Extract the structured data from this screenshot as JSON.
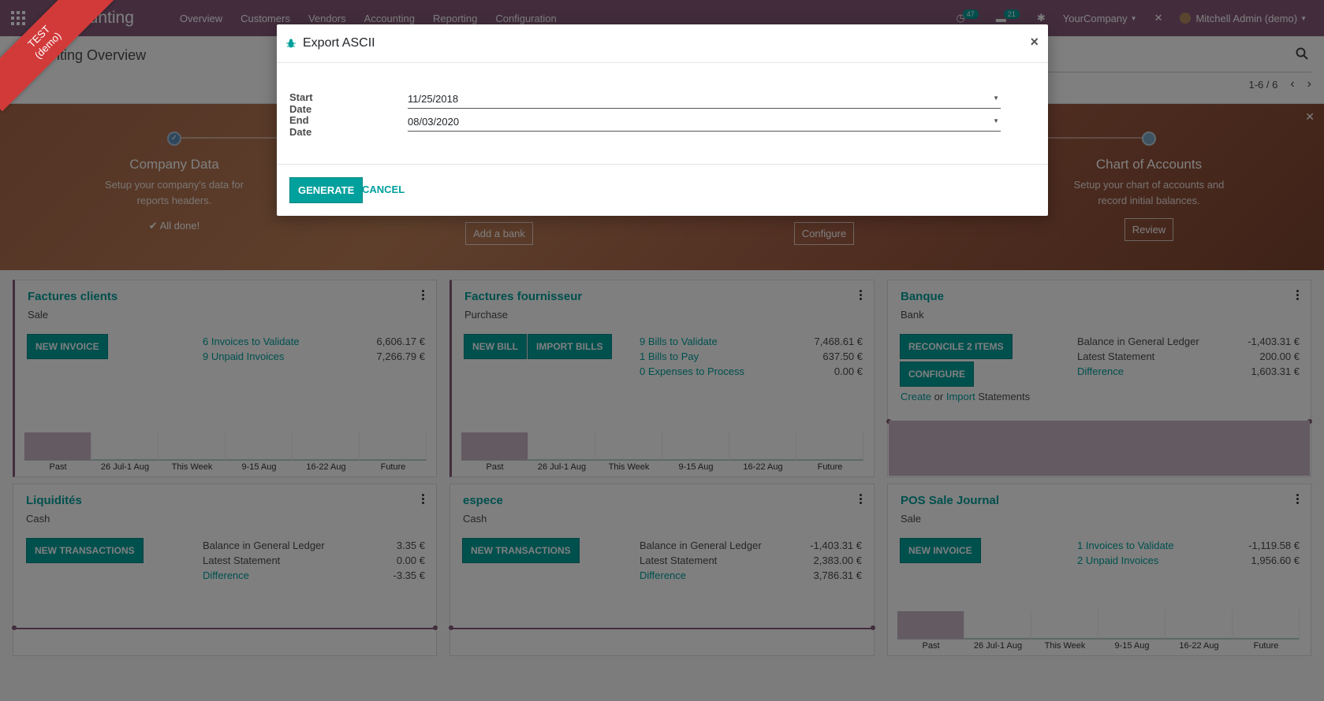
{
  "navbar": {
    "brand": "Accounting",
    "menu": [
      "Overview",
      "Customers",
      "Vendors",
      "Accounting",
      "Reporting",
      "Configuration"
    ],
    "activity_count": "47",
    "message_count": "21",
    "company": "YourCompany",
    "user": "Mitchell Admin (demo)"
  },
  "control_panel": {
    "breadcrumb": "Accounting Overview",
    "pager": "1-6 / 6"
  },
  "onboarding": {
    "steps": [
      {
        "title": "Company Data",
        "desc_line1": "Setup your company's data for",
        "desc_line2": "reports headers.",
        "done": "All done!"
      },
      {
        "button": "Add a bank"
      },
      {
        "button": "Configure"
      },
      {
        "title": "Chart of Accounts",
        "desc_line1": "Setup your chart of accounts and",
        "desc_line2": "record initial balances.",
        "button": "Review"
      }
    ]
  },
  "cards": {
    "factures_clients": {
      "title": "Factures clients",
      "type": "Sale",
      "button": "NEW INVOICE",
      "stats": [
        {
          "label": "6 Invoices to Validate",
          "value": "6,606.17 €"
        },
        {
          "label": "9 Unpaid Invoices",
          "value": "7,266.79 €"
        }
      ]
    },
    "factures_fournisseur": {
      "title": "Factures fournisseur",
      "type": "Purchase",
      "button1": "NEW BILL",
      "button2": "IMPORT BILLS",
      "stats": [
        {
          "label": "9 Bills to Validate",
          "value": "7,468.61 €"
        },
        {
          "label": "1 Bills to Pay",
          "value": "637.50 €"
        },
        {
          "label": "0 Expenses to Process",
          "value": "0.00 €"
        }
      ]
    },
    "banque": {
      "title": "Banque",
      "type": "Bank",
      "button1": "RECONCILE 2 ITEMS",
      "button2": "CONFIGURE",
      "stats": [
        {
          "label": "Balance in General Ledger",
          "value": "-1,403.31 €"
        },
        {
          "label": "Latest Statement",
          "value": "200.00 €"
        },
        {
          "label": "Difference",
          "value": "1,603.31 €"
        }
      ],
      "links": {
        "create": "Create",
        "or": "or",
        "import": "Import",
        "statements": "Statements"
      }
    },
    "liquidites": {
      "title": "Liquidités",
      "type": "Cash",
      "button": "NEW TRANSACTIONS",
      "stats": [
        {
          "label": "Balance in General Ledger",
          "value": "3.35 €"
        },
        {
          "label": "Latest Statement",
          "value": "0.00 €"
        },
        {
          "label": "Difference",
          "value": "-3.35 €"
        }
      ]
    },
    "espece": {
      "title": "espece",
      "type": "Cash",
      "button": "NEW TRANSACTIONS",
      "stats": [
        {
          "label": "Balance in General Ledger",
          "value": "-1,403.31 €"
        },
        {
          "label": "Latest Statement",
          "value": "2,383.00 €"
        },
        {
          "label": "Difference",
          "value": "3,786.31 €"
        }
      ]
    },
    "pos": {
      "title": "POS Sale Journal",
      "type": "Sale",
      "button": "NEW INVOICE",
      "stats": [
        {
          "label": "1 Invoices to Validate",
          "value": "-1,119.58 €"
        },
        {
          "label": "2 Unpaid Invoices",
          "value": "1,956.60 €"
        }
      ]
    }
  },
  "graph_axis": [
    "Past",
    "26 Jul-1 Aug",
    "This Week",
    "9-15 Aug",
    "16-22 Aug",
    "Future"
  ],
  "modal": {
    "title": "Export ASCII",
    "start_label": "Start Date",
    "start_value": "11/25/2018",
    "end_label": "End Date",
    "end_value": "08/03/2020",
    "generate": "GENERATE",
    "cancel": "CANCEL"
  },
  "ribbon": {
    "line1": "TEST",
    "line2": "(demo)"
  },
  "colors": {
    "brand": "#875a7b",
    "primary": "#00a09d"
  }
}
